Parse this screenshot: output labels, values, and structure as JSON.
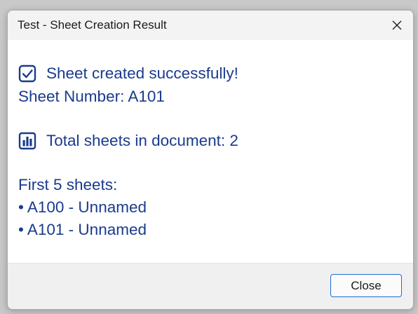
{
  "window": {
    "title": "Test - Sheet Creation Result"
  },
  "message": {
    "success_text": "Sheet created successfully!",
    "sheet_number": "Sheet Number: A101",
    "total_text": "Total sheets in document: 2",
    "list_header": "First 5 sheets:",
    "sheets": [
      "• A100 - Unnamed",
      "• A101 - Unnamed"
    ]
  },
  "icons": {
    "success": "check-box-icon",
    "total": "bar-chart-icon",
    "close": "close-icon"
  },
  "footer": {
    "close_label": "Close"
  },
  "colors": {
    "text": "#1a3b8c",
    "accent": "#1a6fd0"
  }
}
